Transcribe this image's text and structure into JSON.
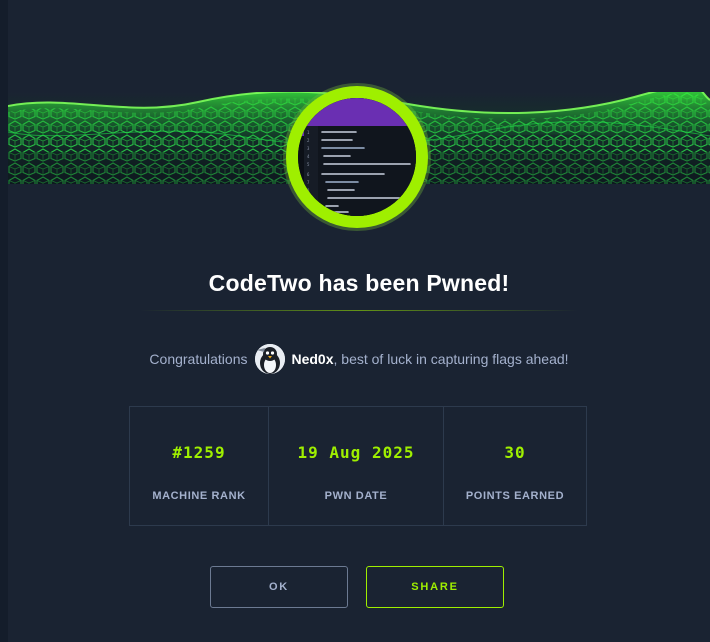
{
  "modal": {
    "title": "CodeTwo has been Pwned!",
    "congrats": {
      "prefix": "Congratulations",
      "username": "Ned0x",
      "suffix": ", best of luck in capturing flags ahead!"
    },
    "stats": [
      {
        "value": "#1259",
        "label": "MACHINE RANK"
      },
      {
        "value": "19 Aug 2025",
        "label": "PWN DATE"
      },
      {
        "value": "30",
        "label": "POINTS EARNED"
      }
    ],
    "buttons": {
      "ok_label": "OK",
      "share_label": "SHARE"
    }
  },
  "colors": {
    "background": "#1a2332",
    "accent": "#9fef00",
    "muted_text": "#a4b1cd",
    "border": "#2d3a4d"
  },
  "icons": {
    "banner": "green-hex-cube-wave-banner",
    "machine": "code-editor-machine-avatar",
    "user": "penguin-user-avatar"
  }
}
